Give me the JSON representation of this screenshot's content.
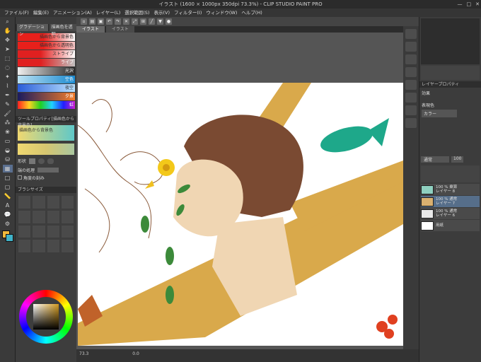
{
  "window": {
    "title": "イラスト (1600 × 1000px 350dpi 73.3%) - CLIP STUDIO PAINT PRO"
  },
  "menu": [
    "ファイル(F)",
    "編集(E)",
    "アニメーション(A)",
    "レイヤー(L)",
    "選択範囲(S)",
    "表示(V)",
    "フィルター(I)",
    "ウィンドウ(W)",
    "ヘルプ(H)"
  ],
  "subtool_panel": {
    "tabs": [
      "グラデーション",
      "描画色を透明"
    ],
    "gradients": [
      {
        "label": "描画色から背景色",
        "colors": [
          "#e8201b",
          "#ffffff"
        ]
      },
      {
        "label": "描画色から透明色",
        "colors": [
          "#e8201b",
          "#f3c8c8"
        ]
      },
      {
        "label": "ストライプ",
        "colors": [
          "#e02020",
          "#ffffff"
        ]
      },
      {
        "label": "ライブ",
        "colors": [
          "#e02020",
          "#c0c0c0"
        ]
      },
      {
        "label": "光沢",
        "colors": [
          "#f0f0f0",
          "#2a2a2a"
        ]
      },
      {
        "label": "空色",
        "colors": [
          "#bce2f3",
          "#1b8ad0"
        ]
      },
      {
        "label": "夜空",
        "colors": [
          "#2a5dd8",
          "#b9e1ff"
        ]
      },
      {
        "label": "夕景",
        "colors": [
          "#1b1b5e",
          "#f47d2a"
        ]
      },
      {
        "label": "虹",
        "colors": [
          "#ff2020",
          "#2020ff"
        ]
      }
    ],
    "tool_property_title": "ツールプロパティ[描画色から背景色]",
    "tool_property_label": "描画色から背景色",
    "shape_label": "形状",
    "edge_label": "端の処理",
    "angle_label": "角度の刻み",
    "brush_size_title": "ブラシサイズ"
  },
  "doc_tabs": [
    "イラスト",
    "イラスト"
  ],
  "colors": {
    "accent": "#566e8a",
    "main_color": "#f0b83c",
    "sub_color": "#3fb3c9"
  },
  "layers": {
    "blend_mode": "通常",
    "opacity": "100",
    "items": [
      {
        "name": "100 % 乗算\nレイヤー 8"
      },
      {
        "name": "100 % 通常\nレイヤー 7"
      },
      {
        "name": "100 % 通常\nレイヤー 6"
      },
      {
        "name": "用紙"
      }
    ]
  },
  "layer_property": {
    "title": "レイヤープロパティ",
    "effect": "効果",
    "expression_color": "表現色",
    "color_value": "カラー"
  },
  "status": {
    "zoom": "73.3",
    "coord": "0.0"
  }
}
